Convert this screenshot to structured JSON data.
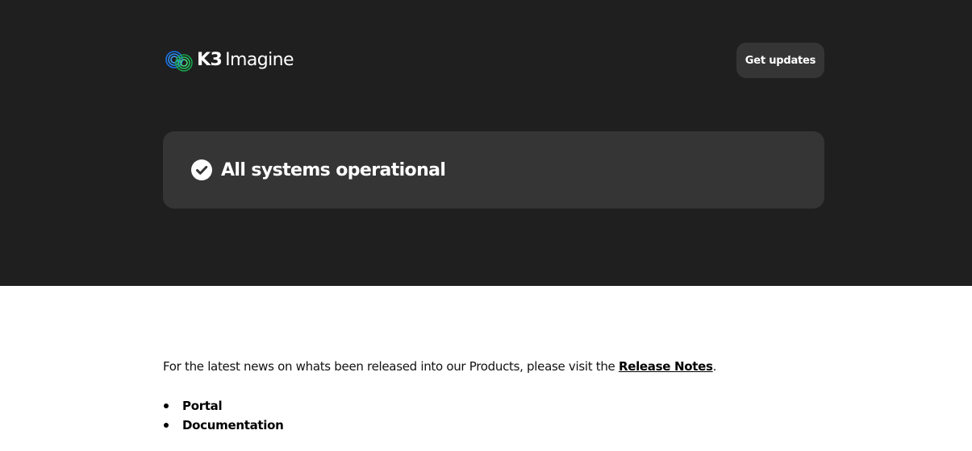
{
  "header": {
    "logo": {
      "brand_bold": "K3",
      "brand_light": "Imagine",
      "icon": "k3-logo-icon"
    },
    "get_updates_label": "Get updates"
  },
  "status": {
    "icon": "check-circle-icon",
    "text": "All systems operational"
  },
  "content": {
    "intro_prefix": "For the latest news on whats been released into our Products, please visit the ",
    "release_notes_link": "Release Notes",
    "intro_suffix": ".",
    "links": [
      {
        "label": "Portal"
      },
      {
        "label": "Documentation"
      }
    ]
  },
  "colors": {
    "hero_bg": "#1f1f1f",
    "card_bg": "#353535",
    "logo_blue": "#1a73e8",
    "logo_green": "#22c55e"
  }
}
